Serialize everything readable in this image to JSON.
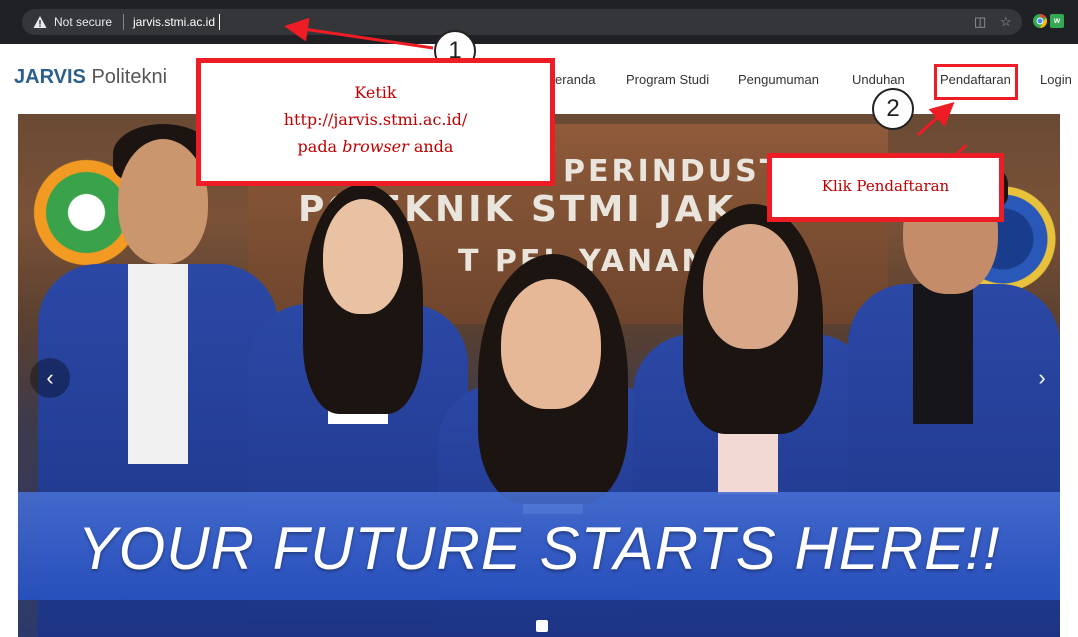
{
  "browser": {
    "security_label": "Not secure",
    "url": "jarvis.stmi.ac.id",
    "icons": [
      "warning-icon",
      "reader-icon",
      "star-icon",
      "chrome-ext-icon",
      "ext-icon"
    ]
  },
  "site": {
    "brand_strong": "JARVIS",
    "brand_rest": " Politekni",
    "nav_items": [
      {
        "label": "eranda"
      },
      {
        "label": "Program Studi"
      },
      {
        "label": "Pengumuman"
      },
      {
        "label": "Unduhan"
      },
      {
        "label": "Pendaftaran"
      },
      {
        "label": "Login"
      }
    ]
  },
  "hero": {
    "sign_line_1": "PERINDUSTRI",
    "sign_line_2": "PO  EKNIK STMI JAK",
    "sign_line_3": "T PEL  YANAN P",
    "banner_text": "YOUR FUTURE STARTS HERE!!",
    "prev_icon": "chevron-left-icon",
    "next_icon": "chevron-right-icon"
  },
  "annotations": {
    "step_1": "1",
    "step_2": "2",
    "callout_1_line_1": "Ketik",
    "callout_1_line_2": "http://jarvis.stmi.ac.id/",
    "callout_1_line_3_prefix": "pada ",
    "callout_1_line_3_em": "browser",
    "callout_1_line_3_suffix": " anda",
    "callout_2": "Klik Pendaftaran",
    "accent_color": "#ee1c24"
  }
}
